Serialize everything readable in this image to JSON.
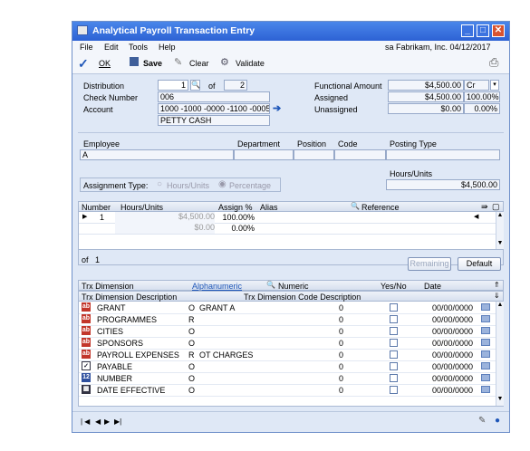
{
  "window": {
    "title": "Analytical Payroll Transaction Entry"
  },
  "menu": [
    "File",
    "Edit",
    "Tools",
    "Help"
  ],
  "menu_status": "sa  Fabrikam, Inc.  04/12/2017",
  "toolbar": {
    "ok": "OK",
    "save": "Save",
    "clear": "Clear",
    "validate": "Validate"
  },
  "header": {
    "distribution_label": "Distribution",
    "distribution_value": "1",
    "of_label": "of",
    "of_value": "2",
    "check_number_label": "Check Number",
    "check_number_value": "006",
    "account_label": "Account",
    "account_value": "1000 -1000 -0000 -1100 -0005",
    "account_desc": "PETTY CASH",
    "functional_amount_label": "Functional Amount",
    "functional_amount_value": "$4,500.00",
    "cr_label": "Cr",
    "assigned_label": "Assigned",
    "assigned_value": "$4,500.00",
    "assigned_pct": "100.00%",
    "unassigned_label": "Unassigned",
    "unassigned_value": "$0.00",
    "unassigned_pct": "0.00%"
  },
  "employee": {
    "employee_label": "Employee",
    "department_label": "Department",
    "position_label": "Position",
    "code_label": "Code",
    "posting_type_label": "Posting Type",
    "employee_value": "A",
    "hours_units_label": "Hours/Units",
    "hours_units_value": "$4,500.00",
    "assignment_type_label": "Assignment Type:",
    "opt_hours": "Hours/Units",
    "opt_percentage": "Percentage"
  },
  "assign_grid": {
    "columns": [
      "Number",
      "Hours/Units",
      "Assign %",
      "Alias",
      "Reference"
    ],
    "rows": [
      {
        "number": "1",
        "hours": "$4,500.00",
        "pct": "100.00%"
      },
      {
        "number": "",
        "hours": "$0.00",
        "pct": "0.00%"
      }
    ],
    "of_label": "of",
    "of_value": "1",
    "remaining_button": "Remaining",
    "default_button": "Default"
  },
  "dimension_grid": {
    "columns": [
      "Trx Dimension",
      "Alphanumeric",
      "Numeric",
      "Yes/No",
      "Date"
    ],
    "columns2": [
      "Trx Dimension Description",
      "Trx Dimension Code Description"
    ],
    "rows": [
      {
        "icon": "ab",
        "name": "GRANT",
        "flag": "O",
        "alpha": "GRANT A",
        "numeric": "0",
        "date": "00/00/0000"
      },
      {
        "icon": "ab",
        "name": "PROGRAMMES",
        "flag": "R",
        "alpha": "",
        "numeric": "0",
        "date": "00/00/0000"
      },
      {
        "icon": "ab",
        "name": "CITIES",
        "flag": "O",
        "alpha": "",
        "numeric": "0",
        "date": "00/00/0000"
      },
      {
        "icon": "ab",
        "name": "SPONSORS",
        "flag": "O",
        "alpha": "",
        "numeric": "0",
        "date": "00/00/0000"
      },
      {
        "icon": "ab",
        "name": "PAYROLL EXPENSES",
        "flag": "R",
        "alpha": "OT CHARGES",
        "numeric": "0",
        "date": "00/00/0000"
      },
      {
        "icon": "check",
        "name": "PAYABLE",
        "flag": "O",
        "alpha": "",
        "numeric": "0",
        "date": "00/00/0000"
      },
      {
        "icon": "12",
        "name": "NUMBER",
        "flag": "O",
        "alpha": "",
        "numeric": "0",
        "date": "00/00/0000"
      },
      {
        "icon": "cal",
        "name": "DATE EFFECTIVE",
        "flag": "O",
        "alpha": "",
        "numeric": "0",
        "date": "00/00/0000"
      }
    ]
  }
}
